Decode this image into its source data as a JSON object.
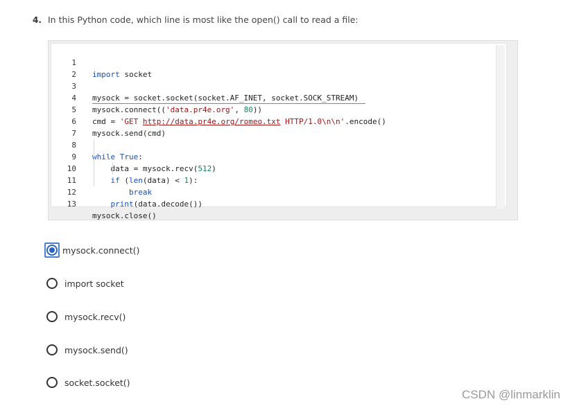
{
  "question": {
    "number": "4.",
    "text": "In this Python code, which line is most like the open() call to read a file:"
  },
  "code": {
    "line_numbers": [
      "1",
      "2",
      "3",
      "4",
      "5",
      "6",
      "7",
      "8",
      "9",
      "10",
      "11",
      "12",
      "13"
    ]
  },
  "options": [
    {
      "label": "mysock.connect()",
      "selected": true
    },
    {
      "label": "import socket",
      "selected": false
    },
    {
      "label": "mysock.recv()",
      "selected": false
    },
    {
      "label": "mysock.send()",
      "selected": false
    },
    {
      "label": "socket.socket()",
      "selected": false
    }
  ],
  "watermark": "CSDN @linmarklin",
  "colors": {
    "keyword": "#1a4fb8",
    "string": "#a31515",
    "number": "#09885a",
    "selected": "#2a62c6"
  }
}
